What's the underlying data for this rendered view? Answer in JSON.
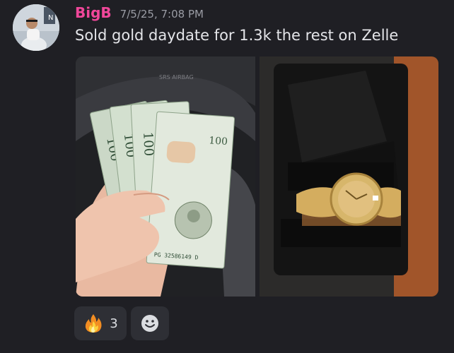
{
  "message": {
    "username": "BigB",
    "timestamp": "7/5/25, 7:08 PM",
    "content": "Sold gold daydate for 1.3k the rest on Zelle",
    "avatar_icon": "user-avatar-photo"
  },
  "attachments": [
    {
      "kind": "photo",
      "subject": "hand holding fanned 100 dollar bills in car",
      "printed_text": [
        "100",
        "100",
        "100",
        "100",
        "PG 32586149 D",
        "SRS AIRBAG"
      ]
    },
    {
      "kind": "photo",
      "subject": "gold day-date wristwatch in black foam case"
    }
  ],
  "reactions": [
    {
      "emoji": "fire-emoji-icon",
      "count": "3"
    }
  ],
  "add_reaction_icon": "smiley-add-reaction-icon",
  "colors": {
    "background": "#1f1f24",
    "username": "#f0479a",
    "timestamp": "#9a9ca4",
    "content_text": "#e4e5e9",
    "reaction_bg": "#2e2f35"
  }
}
